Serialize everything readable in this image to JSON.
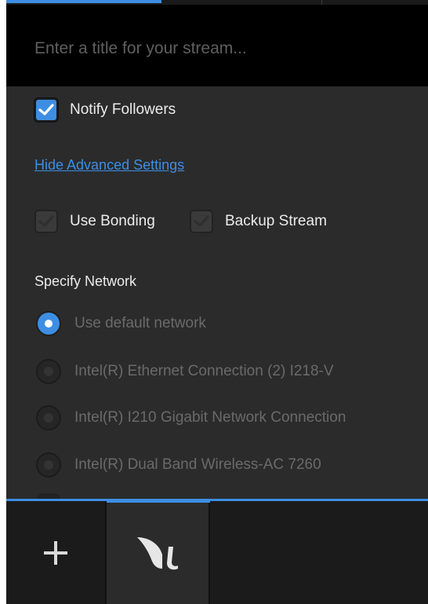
{
  "stream": {
    "title_placeholder": "Enter a title for your stream...",
    "title_value": ""
  },
  "notify": {
    "label": "Notify Followers",
    "checked": true
  },
  "advanced": {
    "link_label": "Hide Advanced Settings"
  },
  "options": [
    {
      "label": "Use Bonding",
      "checked": true,
      "disabled": true
    },
    {
      "label": "Backup Stream",
      "checked": true,
      "disabled": true
    }
  ],
  "network": {
    "title": "Specify Network",
    "options": [
      {
        "label": "Use default network",
        "selected": true
      },
      {
        "label": "Intel(R) Ethernet Connection (2) I218-V",
        "selected": false
      },
      {
        "label": "Intel(R) I210 Gigabit Network Connection",
        "selected": false
      },
      {
        "label": "Intel(R) Dual Band Wireless-AC 7260",
        "selected": false
      }
    ]
  },
  "bottom": {
    "add_icon": "plus-icon",
    "app_icon": "app-logo-icon"
  },
  "colors": {
    "accent": "#3d8ee2",
    "panel": "#2b2b2b",
    "title_bg": "#000000",
    "bottom_bg": "#1b1b1b"
  }
}
